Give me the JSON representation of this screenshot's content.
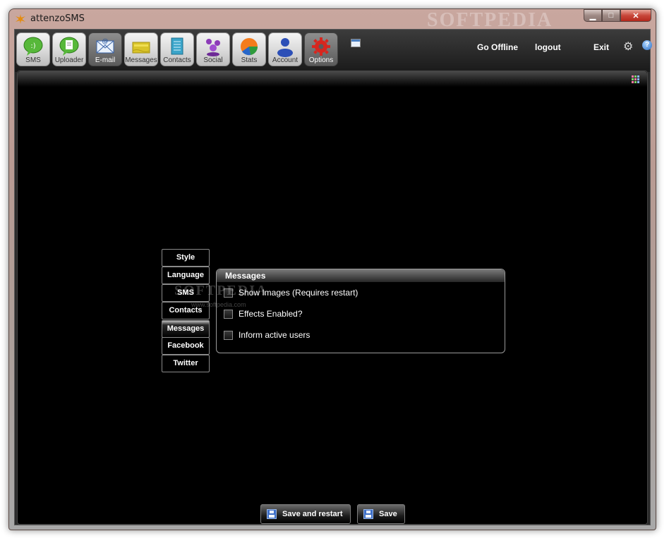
{
  "window": {
    "title": "attenzoSMS",
    "watermark": "SOFTPEDIA",
    "controls": {
      "minimize": "▁",
      "maximize": "□",
      "close": "✕"
    }
  },
  "toolbar": {
    "tabs": [
      {
        "label": "SMS",
        "icon": "sms-bubble-icon"
      },
      {
        "label": "Uploader",
        "icon": "uploader-bubble-icon"
      },
      {
        "label": "E-mail",
        "icon": "email-envelope-icon",
        "active": true
      },
      {
        "label": "Messages",
        "icon": "messages-folder-icon"
      },
      {
        "label": "Contacts",
        "icon": "contacts-book-icon"
      },
      {
        "label": "Social",
        "icon": "social-people-icon"
      },
      {
        "label": "Stats",
        "icon": "stats-pie-icon"
      },
      {
        "label": "Account",
        "icon": "account-person-icon"
      },
      {
        "label": "Options",
        "icon": "options-gear-icon",
        "active": true
      }
    ],
    "links": {
      "go_offline": "Go Offline",
      "logout": "logout",
      "exit": "Exit"
    },
    "gear_glyph": "⚙",
    "help_glyph": "?"
  },
  "options": {
    "side_tabs": [
      "Style",
      "Language",
      "SMS",
      "Contacts",
      "Messages",
      "Facebook",
      "Twitter"
    ],
    "selected_tab": "Messages",
    "group": {
      "title": "Messages",
      "items": [
        {
          "label": "Show Images (Requires restart)",
          "checked": false
        },
        {
          "label": "Effects Enabled?",
          "checked": false
        },
        {
          "label": "Inform active users",
          "checked": false
        }
      ]
    },
    "watermark": "SOFTPEDIA",
    "watermark_sub": "www.softpedia.com"
  },
  "buttons": {
    "save_restart": "Save and restart",
    "save": "Save"
  },
  "colors": {
    "accent_close": "#c8473a",
    "panel_bg": "#000000"
  }
}
